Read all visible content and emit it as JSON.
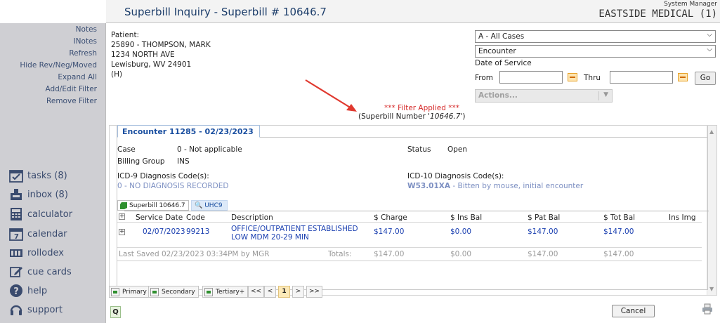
{
  "header": {
    "title": "Superbill Inquiry - Superbill # 10646.7",
    "role": "System Manager",
    "organization": "EASTSIDE MEDICAL (1)"
  },
  "sidebar": {
    "links": [
      "Notes",
      "INotes",
      "Refresh",
      "Hide Rev/Neg/Moved",
      "Expand All",
      "Add/Edit Filter",
      "Remove Filter"
    ],
    "nav": [
      {
        "label": "tasks (8)",
        "icon": "calendar-check-icon"
      },
      {
        "label": "inbox (8)",
        "icon": "inbox-icon"
      },
      {
        "label": "calculator",
        "icon": "calculator-icon"
      },
      {
        "label": "calendar",
        "icon": "calendar-icon"
      },
      {
        "label": "rollodex",
        "icon": "rolodex-icon"
      },
      {
        "label": "cue cards",
        "icon": "edit-icon"
      },
      {
        "label": "help",
        "icon": "help-icon"
      },
      {
        "label": "support",
        "icon": "headset-icon"
      }
    ]
  },
  "patient": {
    "label": "Patient:",
    "id_name": "25890 - THOMPSON, MARK",
    "address1": "1234 NORTH AVE",
    "city_state": "Lewisburg, WV 24901",
    "type": "(H)"
  },
  "filters": {
    "cases_value": "A - All Cases",
    "view_value": "Encounter",
    "date_of_service_label": "Date of Service",
    "from_label": "From",
    "thru_label": "Thru",
    "from_value": "",
    "thru_value": "",
    "go_label": "Go",
    "actions_label": "Actions..."
  },
  "filter_notice": {
    "applied": "*** Filter Applied ***",
    "description_prefix": "(Superbill Number '",
    "description_value": "10646.7",
    "description_suffix": "')"
  },
  "encounter": {
    "tab_label": "Encounter 11285 - 02/23/2023",
    "case_label": "Case",
    "case_value": "0 - Not applicable",
    "billing_group_label": "Billing Group",
    "billing_group_value": "INS",
    "status_label": "Status",
    "status_value": "Open",
    "icd9_label": "ICD-9 Diagnosis Code(s):",
    "icd9_value": "0 - NO DIAGNOSIS RECORDED",
    "icd10_label": "ICD-10 Diagnosis Code(s):",
    "icd10_code": "W53.01XA",
    "icd10_desc": " - Bitten by mouse, initial encounter"
  },
  "superbill_tabs": {
    "superbill": "Superbill 10646.7",
    "payer": "UHC9"
  },
  "table": {
    "headers": [
      "Service Date",
      "Code",
      "Description",
      "$ Charge",
      "$ Ins Bal",
      "$ Pat Bal",
      "$ Tot Bal",
      "Ins Img"
    ],
    "rows": [
      {
        "service_date": "02/07/2023",
        "code": "99213",
        "description_line1": "OFFICE/OUTPATIENT ESTABLISHED",
        "description_line2": "LOW MDM 20-29 MIN",
        "charge": "$147.00",
        "ins_bal": "$0.00",
        "pat_bal": "$147.00",
        "tot_bal": "$147.00",
        "ins_img": ""
      }
    ],
    "last_saved": "Last Saved 02/23/2023 03:34PM by MGR",
    "totals_label": "Totals:",
    "totals": {
      "charge": "$147.00",
      "ins_bal": "$0.00",
      "pat_bal": "$147.00",
      "tot_bal": "$147.00"
    }
  },
  "pager": {
    "primary": "Primary",
    "secondary": "Secondary",
    "tertiary": "Tertiary+",
    "first": "<<",
    "prev": "<",
    "current": "1",
    "next": ">",
    "last": ">>"
  },
  "footer": {
    "q_label": "Q",
    "cancel_label": "Cancel"
  },
  "colors": {
    "sidebar_bg": "#cfcfd3",
    "title_blue": "#1c3d6a",
    "link_blue": "#1a3fb0",
    "filter_red": "#d62b2b",
    "arrow_red": "#e0392f"
  }
}
